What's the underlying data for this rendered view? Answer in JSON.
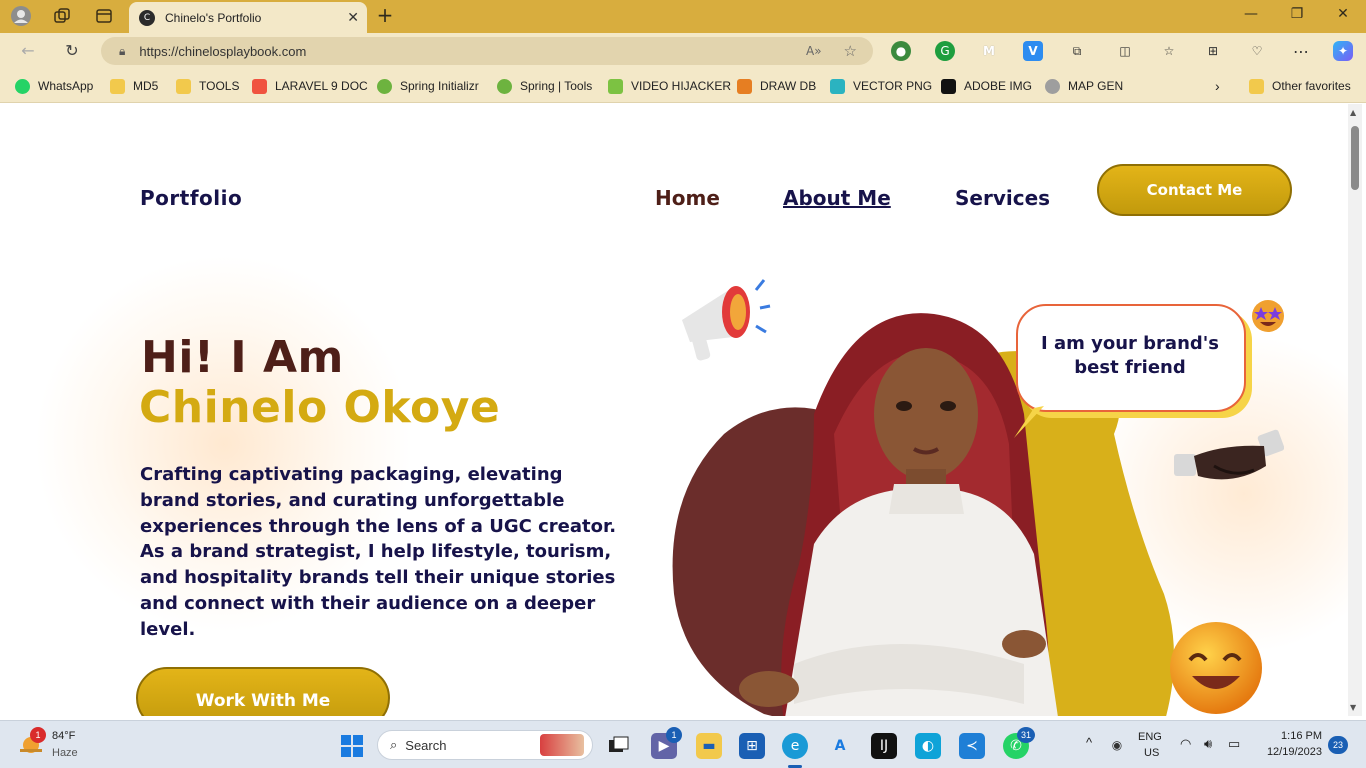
{
  "browser": {
    "tab_title": "Chinelo's Portfolio",
    "url": "https://chinelosplaybook.com",
    "new_tab_label": "+",
    "bookmarks": [
      {
        "label": "WhatsApp",
        "color": "#25d366"
      },
      {
        "label": "MD5",
        "color": "#f2c94c"
      },
      {
        "label": "TOOLS",
        "color": "#f2c94c"
      },
      {
        "label": "LARAVEL 9 DOC",
        "color": "#f05340"
      },
      {
        "label": "Spring Initializr",
        "color": "#6db33f"
      },
      {
        "label": "Spring | Tools",
        "color": "#6db33f"
      },
      {
        "label": "VIDEO HIJACKER",
        "color": "#7cc242"
      },
      {
        "label": "DRAW DB",
        "color": "#e67e22"
      },
      {
        "label": "VECTOR PNG",
        "color": "#2bb3c0"
      },
      {
        "label": "ADOBE IMG",
        "color": "#111111"
      },
      {
        "label": "MAP GEN",
        "color": "#9e9e9e"
      }
    ],
    "other_favorites": "Other favorites"
  },
  "site": {
    "brand": "Portfolio",
    "nav": {
      "home": "Home",
      "about": "About Me",
      "services": "Services"
    },
    "contact_button": "Contact Me",
    "hero": {
      "greeting": "Hi! I Am",
      "name": "Chinelo Okoye",
      "bio": "Crafting captivating packaging, elevating brand stories, and curating unforgettable experiences through the lens of a UGC creator. As a brand strategist, I help lifestyle, tourism, and hospitality brands tell their unique stories and connect with their audience on a deeper level.",
      "cta": "Work With Me"
    },
    "bubble": "I am your brand's best friend",
    "colors": {
      "navy": "#17134a",
      "maroon": "#4e1f18",
      "gold": "#d4aa12",
      "bubble_border": "#e8643a"
    }
  },
  "taskbar": {
    "weather_temp": "84°F",
    "weather_desc": "Haze",
    "weather_badge": "1",
    "search_placeholder": "Search",
    "teams_badge": "1",
    "whatsapp_badge": "31",
    "lang_top": "ENG",
    "lang_bottom": "US",
    "time": "1:16 PM",
    "date": "12/19/2023",
    "notif_count": "23"
  }
}
